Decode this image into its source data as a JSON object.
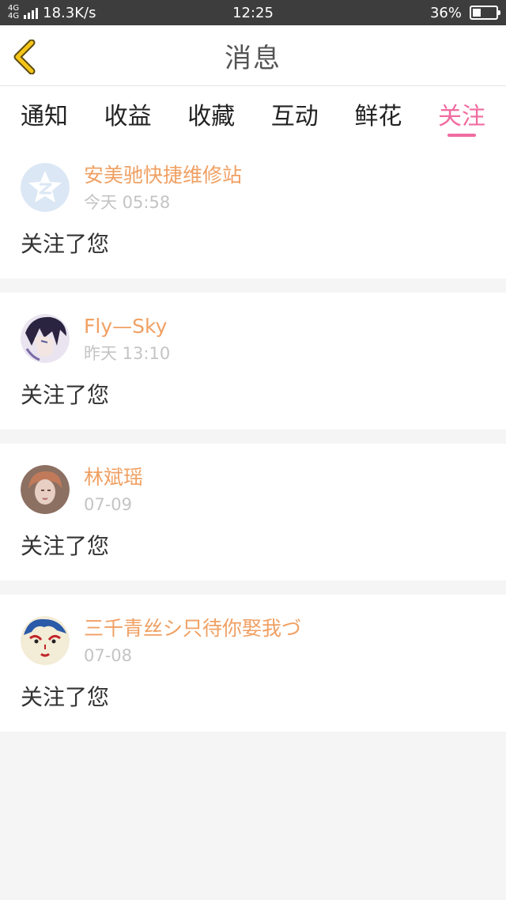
{
  "status_bar": {
    "network_top": "4G",
    "network_bottom": "4G",
    "speed": "18.3K/s",
    "time": "12:25",
    "battery": "36%",
    "battery_level": 0.36
  },
  "nav": {
    "title": "消息",
    "back_icon": "chevron-left-icon",
    "accent": "#f5c518"
  },
  "tabs": [
    {
      "label": "通知"
    },
    {
      "label": "收益"
    },
    {
      "label": "收藏"
    },
    {
      "label": "互动"
    },
    {
      "label": "鲜花"
    },
    {
      "label": "关注"
    }
  ],
  "active_tab": "关注",
  "colors": {
    "active_tab": "#f06ca0",
    "username": "#f0a063",
    "timestamp": "#c4c4c4"
  },
  "feed": [
    {
      "name": "安美驰快捷维修站",
      "time": "今天 05:58",
      "message": "关注了您",
      "avatar": "qzone-logo-avatar"
    },
    {
      "name": "Fly—Sky",
      "time": "昨天 13:10",
      "message": "关注了您",
      "avatar": "anime-boy-avatar"
    },
    {
      "name": "林斌瑶",
      "time": "07-09",
      "message": "关注了您",
      "avatar": "portrait-avatar"
    },
    {
      "name": "三千青丝シ只待你娶我づ",
      "time": "07-08",
      "message": "关注了您",
      "avatar": "painted-face-avatar"
    }
  ]
}
